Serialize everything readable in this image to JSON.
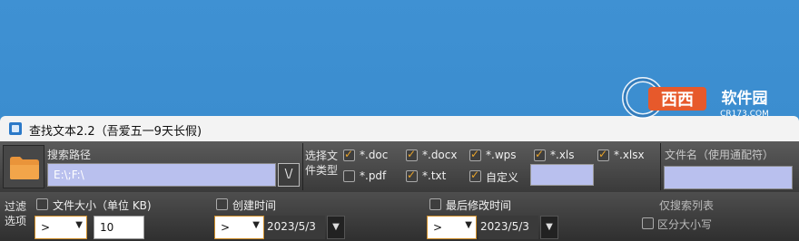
{
  "window": {
    "title": "查找文本2.2（吾爱五一9天长假)"
  },
  "search_path": {
    "label": "搜索路径",
    "value": "E:\\;F:\\",
    "dropdown_glyph": "\\/"
  },
  "file_types": {
    "label": "选择文件类型",
    "items": [
      {
        "label": "*.doc",
        "checked": true
      },
      {
        "label": "*.docx",
        "checked": true
      },
      {
        "label": "*.wps",
        "checked": true
      },
      {
        "label": "*.xls",
        "checked": true
      },
      {
        "label": "*.xlsx",
        "checked": true
      },
      {
        "label": "*.pdf",
        "checked": false
      },
      {
        "label": "*.txt",
        "checked": true
      },
      {
        "label": "自定义",
        "checked": true
      }
    ],
    "custom_value": ""
  },
  "filename": {
    "label": "文件名（使用通配符）",
    "value": ""
  },
  "filter": {
    "label": "过滤选项",
    "size": {
      "label": "文件大小（单位 KB)",
      "checked": false,
      "op": ">",
      "value": "10"
    },
    "created": {
      "label": "创建时间",
      "checked": false,
      "op": ">",
      "date": "2023/5/3"
    },
    "modified": {
      "label": "最后修改时间",
      "checked": false,
      "op": ">",
      "date": "2023/5/3"
    },
    "partial_1": "仅搜索列表",
    "case_sensitive": {
      "label": "区分大小写",
      "checked": false
    }
  },
  "watermark": {
    "text": "西西软件园",
    "url": "CR173.COM"
  },
  "colors": {
    "accent_check": "#e9a42a",
    "input_fill": "#b9c0ee",
    "panel": "#3a3a3a"
  },
  "icons": {
    "folder": "folder-icon",
    "dropdown": "chevron-down-icon",
    "date": "calendar-dropdown-icon"
  }
}
